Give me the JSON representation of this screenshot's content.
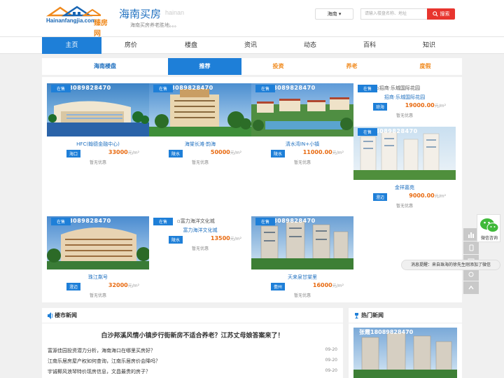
{
  "header": {
    "logo_url_text": "Hainanfangjia.com",
    "logo_brand": "臻房网",
    "site_title": "海南买房",
    "site_pinyin": "hainan",
    "slogan": "海南买房养老胜地。。。",
    "city_select": "海南 ▾",
    "search_placeholder": "请输入楼盘名称、地址",
    "search_button": "搜索"
  },
  "nav": {
    "items": [
      "主页",
      "房价",
      "楼盘",
      "资讯",
      "动态",
      "百科",
      "知识"
    ],
    "active_index": 0
  },
  "tabs": {
    "items": [
      "海南楼盘",
      "推荐",
      "投资",
      "养老",
      "度假"
    ],
    "active_index": 1
  },
  "watermark": "张霞18089828470",
  "listings": [
    {
      "badge": "在售",
      "name": "HFC(翰德金融中心)",
      "area": "海口",
      "price": "33000",
      "unit": "元/m²",
      "promo": "暂无优惠"
    },
    {
      "badge": "在售",
      "name": "海棠长滩·韵海",
      "area": "陵水",
      "price": "50000",
      "unit": "元/m²",
      "promo": "暂无优惠"
    },
    {
      "badge": "在售",
      "name": "清水湾IN+小镇",
      "area": "陵水",
      "price": "11000.00",
      "unit": "元/m²",
      "promo": "暂无优惠"
    },
    {
      "badge": "在售",
      "name": "招商·乐城国际花园",
      "broken_alt": "招商·乐城国际花园",
      "area": "琼海",
      "price": "19000.00",
      "unit": "元/m²",
      "promo": "暂无优惠"
    },
    {
      "badge": "在售",
      "name": "金祥嘉苑",
      "area": "澄迈",
      "price": "9000.00",
      "unit": "元/m²",
      "promo": "暂无优惠"
    },
    {
      "badge": "在售",
      "name": "珠江粼号",
      "area": "澄迈",
      "price": "32000",
      "unit": "元/m²",
      "promo": "暂无优惠"
    },
    {
      "badge": "在售",
      "name": "富力海洋文化城",
      "broken_alt": "富力海洋文化城",
      "area": "陵水",
      "price": "13500",
      "unit": "元/m²",
      "promo": "暂无优惠"
    },
    {
      "badge": "在售",
      "name": "天来泉甘棠里",
      "area": "儋州",
      "price": "16000",
      "unit": "元/m²",
      "promo": "暂无优惠"
    }
  ],
  "side": {
    "wechat_label": "微信咨询",
    "toast": "消息提醒：来自珠海的徐先生刚添加了微信"
  },
  "news": {
    "title": "楼市新闻",
    "headline": "白沙邦溪风情小镇步行街新房不适合养老？江苏丈母娘答案来了！",
    "items": [
      {
        "title": "富源佳园投资潜力分析，海南海口在哪里买房好？",
        "date": "09-20"
      },
      {
        "title": "江南乐居房屋产权如何查询，江南乐居房价会降吗？",
        "date": "09-20"
      },
      {
        "title": "宇诚椰风浪琴特价现房信息，文昌最贵的房子？",
        "date": "09-20"
      }
    ]
  },
  "hot": {
    "title": "热门新闻"
  },
  "colors": {
    "primary": "#1e7fd8",
    "accent": "#f08a1e",
    "price": "#e86a10",
    "search": "#e8352e"
  }
}
